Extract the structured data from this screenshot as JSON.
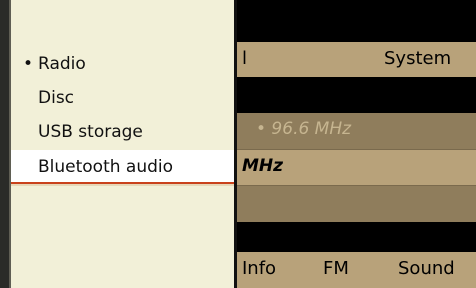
{
  "popup_menu": {
    "items": [
      {
        "label": "Radio",
        "active": true,
        "bullet": "•"
      },
      {
        "label": "Disc",
        "active": false,
        "bullet": ""
      },
      {
        "label": "USB storage",
        "active": false,
        "bullet": ""
      },
      {
        "label": "Bluetooth audio",
        "active": false,
        "bullet": "",
        "highlighted": true
      }
    ],
    "highlight_color": "#c9421c"
  },
  "background_screen": {
    "top_menu": {
      "left_fragment": "l",
      "system_label": "System"
    },
    "station_frequency": "• 96.6 MHz",
    "frequency_fragment": "MHz",
    "bottom_menu": {
      "info_label": "Info",
      "band_label": "FM",
      "sound_label": "Sound"
    }
  },
  "colors": {
    "menu_background": "#f2f0d8",
    "screen_bar": "#b8a27a",
    "screen_background": "#000000"
  }
}
